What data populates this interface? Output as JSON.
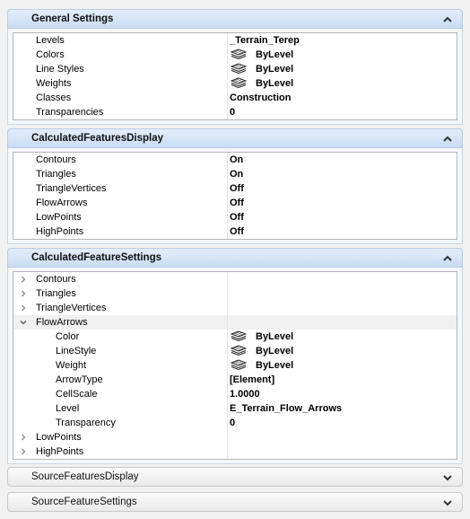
{
  "panels": {
    "general": {
      "title": "General Settings",
      "rows": [
        {
          "name": "Levels",
          "value": "_Terrain_Terep",
          "icon": false,
          "weight": "normal"
        },
        {
          "name": "Colors",
          "value": "ByLevel",
          "icon": true
        },
        {
          "name": "Line Styles",
          "value": "ByLevel",
          "icon": true
        },
        {
          "name": "Weights",
          "value": "ByLevel",
          "icon": true
        },
        {
          "name": "Classes",
          "value": "Construction",
          "icon": false
        },
        {
          "name": "Transparencies",
          "value": "0",
          "icon": false
        }
      ]
    },
    "calc_display": {
      "title": "CalculatedFeaturesDisplay",
      "rows": [
        {
          "name": "Contours",
          "value": "On"
        },
        {
          "name": "Triangles",
          "value": "On"
        },
        {
          "name": "TriangleVertices",
          "value": "Off"
        },
        {
          "name": "FlowArrows",
          "value": "Off"
        },
        {
          "name": "LowPoints",
          "value": "Off"
        },
        {
          "name": "HighPoints",
          "value": "Off"
        }
      ]
    },
    "calc_settings": {
      "title": "CalculatedFeatureSettings",
      "groups": [
        {
          "name": "Contours",
          "expanded": false
        },
        {
          "name": "Triangles",
          "expanded": false
        },
        {
          "name": "TriangleVertices",
          "expanded": false
        },
        {
          "name": "FlowArrows",
          "expanded": true
        },
        {
          "name": "LowPoints",
          "expanded": false
        },
        {
          "name": "HighPoints",
          "expanded": false
        }
      ],
      "flow_arrows_children": [
        {
          "name": "Color",
          "value": "ByLevel",
          "icon": true
        },
        {
          "name": "LineStyle",
          "value": "ByLevel",
          "icon": true
        },
        {
          "name": "Weight",
          "value": "ByLevel",
          "icon": true
        },
        {
          "name": "ArrowType",
          "value": "[Element]",
          "icon": false
        },
        {
          "name": "CellScale",
          "value": "1.0000",
          "icon": false
        },
        {
          "name": "Level",
          "value": "E_Terrain_Flow_Arrows",
          "icon": false
        },
        {
          "name": "Transparency",
          "value": "0",
          "icon": false
        }
      ]
    },
    "source_display": {
      "title": "SourceFeaturesDisplay"
    },
    "source_settings": {
      "title": "SourceFeatureSettings"
    }
  },
  "icons": {
    "collapse": "chevron-up-icon",
    "expand": "chevron-down-icon",
    "row_collapsed": "chevron-right-icon",
    "row_expanded": "chevron-down-icon",
    "bylevel": "bylevel-icon"
  },
  "colors": {
    "header_gradient_top": "#e4eefa",
    "header_gradient_bottom": "#c9dcf4",
    "panel_background": "#f4f7fb"
  }
}
